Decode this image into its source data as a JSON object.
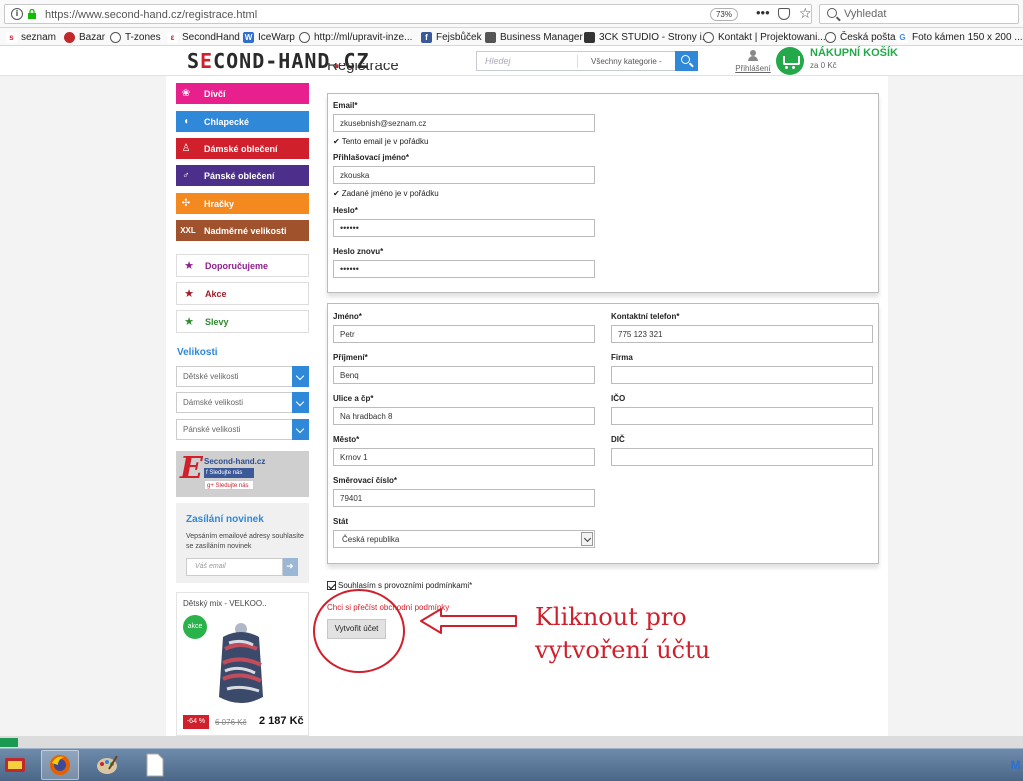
{
  "browser": {
    "url": "https://www.second-hand.cz/registrace.html",
    "zoom": "73%",
    "search_placeholder": "Vyhledat",
    "bookmarks": [
      "seznam",
      "Bazar",
      "T-zones",
      "SecondHand",
      "IceWarp",
      "http://ml/upravit-inze...",
      "Fejsbůček",
      "Business Manager",
      "3CK STUDIO - Strony i...",
      "Kontakt | Projektowani...",
      "Česká pošta",
      "Foto kámen 150 x 200 ..."
    ]
  },
  "header": {
    "logo_part1": "S",
    "logo_e": "E",
    "logo_part2": "COND-HAND",
    "logo_dot": ".",
    "logo_tld": "CZ",
    "search_placeholder": "Hledej",
    "category_select": "Všechny kategorie -",
    "login_label": "Přihlášení",
    "cart_title": "NÁKUPNÍ KOŠÍK",
    "cart_sum": "za 0 Kč"
  },
  "sidebar": {
    "categories": [
      {
        "label": "Dívčí",
        "color": "#e8208e",
        "icon": "👗"
      },
      {
        "label": "Chlapecké",
        "color": "#2f88d8",
        "icon": "🐘"
      },
      {
        "label": "Dámské oblečení",
        "color": "#d0202c",
        "icon": "👗"
      },
      {
        "label": "Pánské oblečení",
        "color": "#4b2f8a",
        "icon": "👔"
      },
      {
        "label": "Hračky",
        "color": "#f4891f",
        "icon": "🧸"
      },
      {
        "label": "Nadměrné velikosti",
        "color": "#a0522d",
        "icon": "XXL"
      }
    ],
    "tags": [
      {
        "label": "Doporučujeme",
        "color": "#8e1e8e"
      },
      {
        "label": "Akce",
        "color": "#a01d2a"
      },
      {
        "label": "Slevy",
        "color": "#2e8b2e"
      }
    ],
    "sizes_title": "Velikosti",
    "size_selects": [
      "Dětské velikosti",
      "Dámské velikosti",
      "Pánské velikosti"
    ],
    "fb_name": "Second-hand.cz",
    "fb_follow": "Sledujte nás",
    "gplus_follow": "Sledujte nás",
    "newsletter": {
      "title": "Zasílání novinek",
      "text": "Vepsáním emailové adresy souhlasíte se zasíláním novinek",
      "placeholder": "Váš email"
    },
    "product": {
      "name": "Dětský mix - VELKOO..",
      "badge": "akce",
      "discount": "-64 %",
      "old_price": "6 076 Kč",
      "price": "2 187 Kč"
    }
  },
  "form": {
    "heading": "Registrace",
    "account": {
      "email_label": "Email*",
      "email_value": "zkusebnish@seznam.cz",
      "email_ok": "Tento email je v pořádku",
      "login_label": "Přihlašovací jméno*",
      "login_value": "zkouska",
      "login_ok": "Zadané jméno je v pořádku",
      "password_label": "Heslo*",
      "password_value": "••••••",
      "password2_label": "Heslo znovu*",
      "password2_value": "••••••"
    },
    "address": {
      "first_name_label": "Jméno*",
      "first_name_value": "Petr",
      "phone_label": "Kontaktní telefon*",
      "phone_value": "775 123 321",
      "last_name_label": "Příjmení*",
      "last_name_value": "Benq",
      "company_label": "Firma",
      "company_value": "",
      "street_label": "Ulice a čp*",
      "street_value": "Na hradbach 8",
      "ico_label": "IČO",
      "ico_value": "",
      "city_label": "Město*",
      "city_value": "Krnov 1",
      "dic_label": "DIČ",
      "dic_value": "",
      "zip_label": "Směrovací číslo*",
      "zip_value": "79401",
      "country_label": "Stát",
      "country_value": "Česká republika"
    },
    "terms_label": "Souhlasím s provozními podmínkami*",
    "terms_link": "Chci si přečíst obchodní podmínky",
    "submit_label": "Vytvořit účet"
  },
  "annotation": {
    "line1": "Kliknout pro",
    "line2": "vytvoření účtu"
  }
}
